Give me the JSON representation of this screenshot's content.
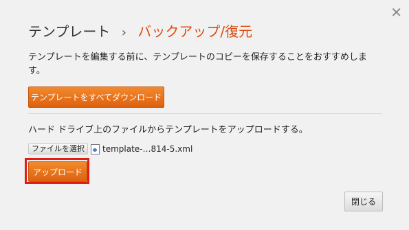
{
  "dialog": {
    "close_icon_glyph": "✕",
    "breadcrumb": {
      "parent": "テンプレート",
      "separator": "›",
      "current": "バックアップ/復元"
    },
    "description": "テンプレートを編集する前に、テンプレートのコピーを保存することをおすすめします。",
    "download_button_label": "テンプレートをすべてダウンロード",
    "upload_description": "ハード ドライブ上のファイルからテンプレートをアップロードする。",
    "file_input": {
      "choose_label": "ファイルを選択",
      "file_name": "template-…814-5.xml"
    },
    "upload_button_label": "アップロード",
    "close_button_label": "閉じる"
  },
  "colors": {
    "accent": "#dd4b10",
    "button_orange": "#e8761f",
    "highlight_red": "#e21d16"
  }
}
